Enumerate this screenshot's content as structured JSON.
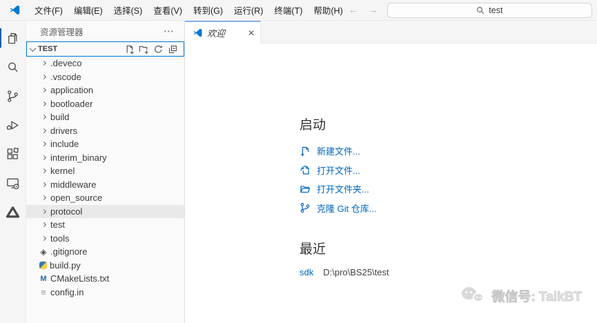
{
  "icons": {
    "ellipsis": "⋯",
    "close": "✕",
    "arrow_left": "←",
    "arrow_right": "→"
  },
  "colors": {
    "accent": "#005fb8",
    "focus_border": "#0078d4",
    "link": "#0066bf",
    "tab_active_border": "#8ab4e2"
  },
  "title_bar": {
    "app_icon": "vscode-logo-icon",
    "menus": [
      {
        "label": "文件(F)"
      },
      {
        "label": "编辑(E)"
      },
      {
        "label": "选择(S)"
      },
      {
        "label": "查看(V)"
      },
      {
        "label": "转到(G)"
      },
      {
        "label": "运行(R)"
      },
      {
        "label": "终端(T)"
      },
      {
        "label": "帮助(H)"
      }
    ],
    "search": {
      "value": "test",
      "icon": "search-icon"
    }
  },
  "activity_bar": {
    "items": [
      {
        "icon": "explorer-icon",
        "active": true
      },
      {
        "icon": "search-icon"
      },
      {
        "icon": "source-control-icon"
      },
      {
        "icon": "run-debug-icon"
      },
      {
        "icon": "extensions-icon"
      },
      {
        "icon": "remote-explorer-icon"
      },
      {
        "icon": "deveco-device-tool-icon"
      }
    ]
  },
  "sidebar": {
    "title": "资源管理器",
    "section": {
      "label": "TEST",
      "actions": [
        {
          "icon": "new-file-icon"
        },
        {
          "icon": "new-folder-icon"
        },
        {
          "icon": "refresh-icon"
        },
        {
          "icon": "collapse-all-icon"
        }
      ]
    },
    "tree": [
      {
        "label": ".deveco",
        "icon": "chevron-right-icon"
      },
      {
        "label": ".vscode",
        "icon": "chevron-right-icon"
      },
      {
        "label": "application",
        "icon": "chevron-right-icon"
      },
      {
        "label": "bootloader",
        "icon": "chevron-right-icon"
      },
      {
        "label": "build",
        "icon": "chevron-right-icon"
      },
      {
        "label": "drivers",
        "icon": "chevron-right-icon"
      },
      {
        "label": "include",
        "icon": "chevron-right-icon"
      },
      {
        "label": "interim_binary",
        "icon": "chevron-right-icon"
      },
      {
        "label": "kernel",
        "icon": "chevron-right-icon"
      },
      {
        "label": "middleware",
        "icon": "chevron-right-icon"
      },
      {
        "label": "open_source",
        "icon": "chevron-right-icon"
      },
      {
        "label": "protocol",
        "icon": "chevron-right-icon",
        "state": "hover"
      },
      {
        "label": "test",
        "icon": "chevron-right-icon"
      },
      {
        "label": "tools",
        "icon": "chevron-right-icon"
      },
      {
        "label": ".gitignore",
        "icon": "git-icon"
      },
      {
        "label": "build.py",
        "icon": "python-icon"
      },
      {
        "label": "CMakeLists.txt",
        "icon": "cmake-icon"
      },
      {
        "label": "config.in",
        "icon": "config-icon"
      }
    ]
  },
  "editor": {
    "tab": {
      "icon": "vscode-logo-icon",
      "label": "欢迎",
      "preview": true
    },
    "welcome": {
      "start": {
        "heading": "启动",
        "links": [
          {
            "label": "新建文件...",
            "icon": "new-file-icon"
          },
          {
            "label": "打开文件...",
            "icon": "open-file-icon"
          },
          {
            "label": "打开文件夹...",
            "icon": "open-folder-icon"
          },
          {
            "label": "克隆 Git 仓库...",
            "icon": "git-clone-icon"
          }
        ]
      },
      "recent": {
        "heading": "最近",
        "items": [
          {
            "name": "sdk",
            "path": "D:\\pro\\BS25\\test"
          }
        ]
      }
    }
  },
  "watermark": {
    "icon": "wechat-icon",
    "text": "微信号: TalkBT"
  }
}
